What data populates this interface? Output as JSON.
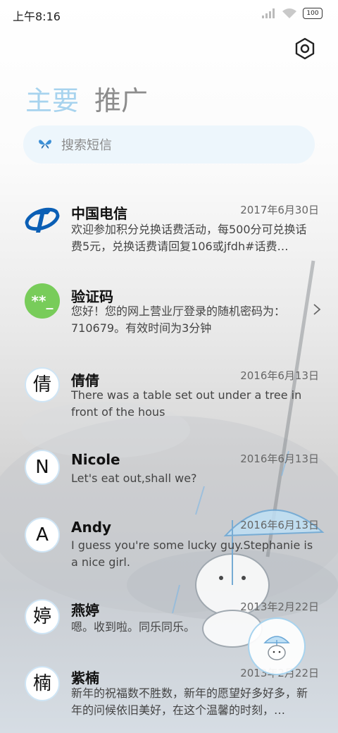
{
  "status_bar": {
    "time": "上午8:16",
    "battery": "100"
  },
  "header": {
    "settings_icon": "gear-icon",
    "tabs": [
      {
        "label": "主要",
        "active": true
      },
      {
        "label": "推广",
        "active": false
      }
    ]
  },
  "search": {
    "placeholder": "搜索短信",
    "icon": "butterfly-icon"
  },
  "conversations": [
    {
      "name": "中国电信",
      "date": "2017年6月30日",
      "preview": "欢迎参加积分兑换话费活动，每500分可兑换话费5元，兑换话费请回复106或jfdh#话费…",
      "avatar": "china-telecom-logo"
    },
    {
      "name": "验证码",
      "date": "",
      "preview": "您好！您的网上营业厅登录的随机密码为：710679。有效时间为3分钟",
      "avatar_text": "**_"
    },
    {
      "name": "倩倩",
      "date": "2016年6月13日",
      "preview": "There was a table set out under a tree in front of the hous",
      "avatar_text": "倩"
    },
    {
      "name": "Nicole",
      "date": "2016年6月13日",
      "preview": "Let's eat out,shall we?",
      "avatar_text": "N"
    },
    {
      "name": "Andy",
      "date": "2016年6月13日",
      "preview": "I guess you're some lucky guy.Stephanie is a nice girl.",
      "avatar_text": "A"
    },
    {
      "name": "燕婷",
      "date": "2013年2月22日",
      "preview": "嗯。收到啦。同乐同乐。",
      "avatar_text": "婷"
    },
    {
      "name": "紫楠",
      "date": "2013年2月22日",
      "preview": "新年的祝福数不胜数，新年的愿望好多好多，新年的问候依旧美好，在这个温馨的时刻，…",
      "avatar_text": "楠"
    }
  ],
  "colors": {
    "tab_active": "#a7d3ee",
    "tab_inactive": "#8c8c8c",
    "verify_avatar": "#78cc5a",
    "telecom_blue": "#0b5fb5"
  }
}
